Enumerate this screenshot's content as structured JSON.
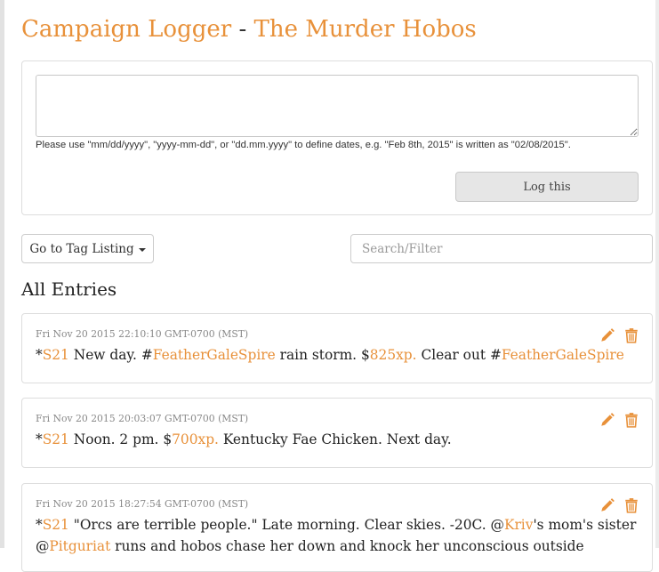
{
  "header": {
    "app_name": "Campaign Logger",
    "separator": "-",
    "campaign_name": "The Murder Hobos"
  },
  "log_form": {
    "entry_value": "",
    "date_hint": "Please use \"mm/dd/yyyy\", \"yyyy-mm-dd\", or \"dd.mm.yyyy\" to define dates, e.g. \"Feb 8th, 2015\" is written as \"02/08/2015\".",
    "submit_label": "Log this"
  },
  "controls": {
    "tag_listing_label": "Go to Tag Listing",
    "search_placeholder": "Search/Filter"
  },
  "section_title": "All Entries",
  "entries": [
    {
      "timestamp": "Fri Nov 20 2015 22:10:10 GMT-0700 (MST)",
      "text": {
        "t1": "*",
        "l1": "S21",
        "t2": " New day. #",
        "l2": "FeatherGaleSpire",
        "t3": " rain storm. $",
        "l3": "825xp.",
        "t4": " Clear out #",
        "l4": "FeatherGaleSpire"
      }
    },
    {
      "timestamp": "Fri Nov 20 2015 20:03:07 GMT-0700 (MST)",
      "text": {
        "t1": "*",
        "l1": "S21",
        "t2": " Noon. 2 pm. $",
        "l2": "700xp.",
        "t3": " Kentucky Fae Chicken. Next day."
      }
    },
    {
      "timestamp": "Fri Nov 20 2015 18:27:54 GMT-0700 (MST)",
      "text": {
        "t1": "*",
        "l1": "S21",
        "t2": " \"Orcs are terrible people.\" Late morning. Clear skies. -20C. @",
        "l2": "Kriv",
        "t3": "'s mom's sister",
        "t4": "@",
        "l3": "Pitguriat",
        "t5": " runs and hobos chase her down and knock her unconscious outside"
      }
    }
  ],
  "icons": {
    "edit": "pencil-icon",
    "delete": "trash-icon",
    "dropdown": "caret-down-icon"
  },
  "colors": {
    "accent": "#e8913a",
    "text": "#222222",
    "muted": "#888888",
    "border": "#dddddd"
  }
}
